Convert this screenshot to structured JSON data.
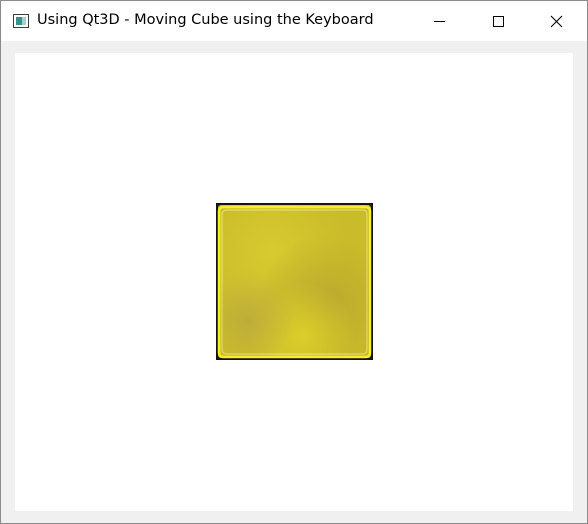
{
  "window": {
    "title": "Using Qt3D - Moving Cube using the Keyboard",
    "icon": "qt-window-app-icon",
    "controls": {
      "minimize_icon": "minimize-icon",
      "maximize_icon": "maximize-icon",
      "close_icon": "close-icon"
    }
  },
  "scene": {
    "background_color": "#ffffff",
    "object": "textured-cube",
    "cube_colors": {
      "face": "#c9bb2a",
      "highlight": "#f6ee28",
      "edge": "#141414"
    }
  }
}
